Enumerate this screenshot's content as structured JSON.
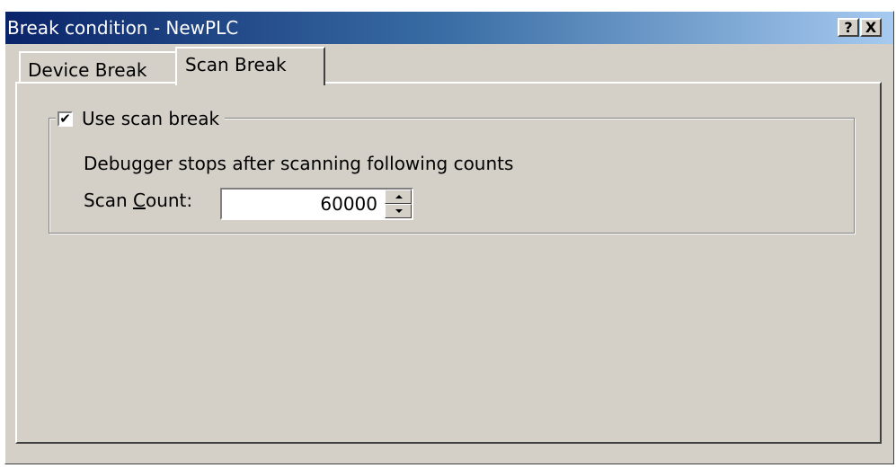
{
  "window": {
    "title": "Break condition - NewPLC",
    "help_button": "?",
    "close_button": "X"
  },
  "tabs": [
    {
      "label": "Device Break",
      "selected": false
    },
    {
      "label": "Scan Break",
      "selected": true
    }
  ],
  "scan_break": {
    "checkbox_label": "Use scan break",
    "checked": true,
    "checkmark": "✔",
    "description": "Debugger stops after scanning following counts",
    "count_label_prefix": "Scan ",
    "count_label_accel": "C",
    "count_label_suffix": "ount:",
    "count_value": "60000"
  }
}
